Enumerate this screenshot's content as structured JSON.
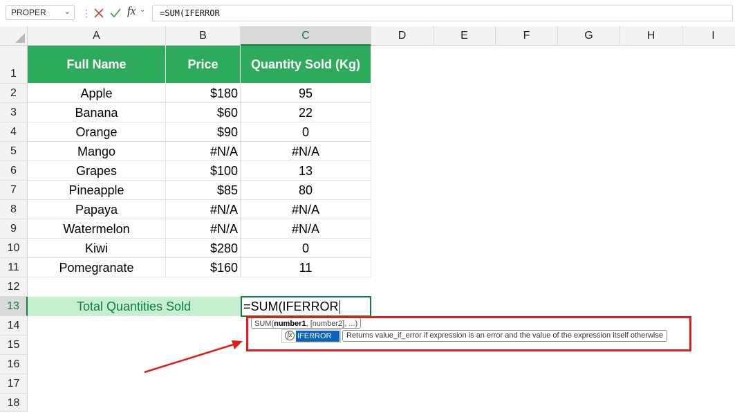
{
  "formula_bar": {
    "name_box": "PROPER",
    "formula": "=SUM(IFERROR"
  },
  "columns": [
    "A",
    "B",
    "C",
    "D",
    "E",
    "F",
    "G",
    "H",
    "I"
  ],
  "rows": [
    "1",
    "2",
    "3",
    "4",
    "5",
    "6",
    "7",
    "8",
    "9",
    "10",
    "11",
    "12",
    "13",
    "14",
    "15",
    "16",
    "17",
    "18"
  ],
  "table": {
    "headers": [
      "Full Name",
      "Price",
      "Quantity Sold (Kg)"
    ],
    "rows": [
      [
        "Apple",
        "$180",
        "95"
      ],
      [
        "Banana",
        "$60",
        "22"
      ],
      [
        "Orange",
        "$90",
        "0"
      ],
      [
        "Mango",
        "#N/A",
        "#N/A"
      ],
      [
        "Grapes",
        "$100",
        "13"
      ],
      [
        "Pineapple",
        "$85",
        "80"
      ],
      [
        "Papaya",
        "#N/A",
        "#N/A"
      ],
      [
        "Watermelon",
        "#N/A",
        "#N/A"
      ],
      [
        "Kiwi",
        "$280",
        "0"
      ],
      [
        "Pomegranate",
        "$160",
        "11"
      ]
    ]
  },
  "total": {
    "label": "Total Quantities Sold",
    "editing_value": "=SUM(IFERROR"
  },
  "tooltip": {
    "signature_prefix": "SUM(",
    "signature_bold": "number1",
    "signature_suffix": ", [number2], ...)",
    "autocomplete_item": "IFERROR",
    "description": "Returns value_if_error if expression is an error and the value of the expression itself otherwise"
  },
  "colors": {
    "header_fill": "#2eaa5c",
    "total_fill": "#c6efce",
    "accent": "#107c41",
    "annotation": "#e21b1b"
  }
}
